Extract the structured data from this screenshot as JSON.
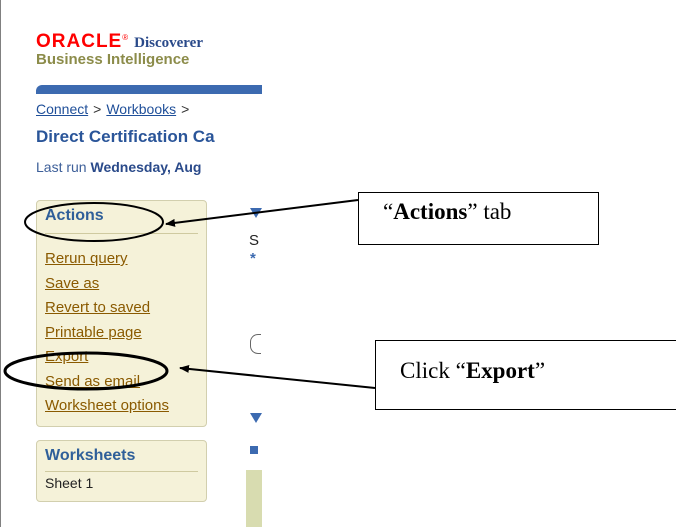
{
  "header": {
    "logo_text": "ORACLE",
    "logo_mark": "®",
    "product": "Discoverer",
    "subtitle": "Business Intelligence"
  },
  "breadcrumb": {
    "items": [
      "Connect",
      "Workbooks"
    ],
    "separator": ">"
  },
  "page_title": "Direct Certification Ca",
  "last_run": {
    "prefix": "Last run",
    "value": "Wednesday, Aug"
  },
  "actions_panel": {
    "title": "Actions",
    "items": [
      "Rerun query",
      "Save as",
      "Revert to saved",
      "Printable page",
      "Export",
      "Send as email",
      "Worksheet options"
    ]
  },
  "worksheets_panel": {
    "title": "Worksheets",
    "items": [
      "Sheet 1"
    ]
  },
  "content_fragments": {
    "letter_s": "S",
    "asterisk": "*"
  },
  "annotations": {
    "actions_callout": {
      "q_open": "“",
      "bold": "Actions",
      "q_close": "”",
      "rest": " tab"
    },
    "export_callout": {
      "prefix": "Click ",
      "q_open": "“",
      "bold": "Export",
      "q_close": "”"
    }
  },
  "colors": {
    "oracle_red": "#ff0000",
    "link_brown": "#8a5a00",
    "title_blue": "#2a5599",
    "panel_bg": "#f5f2d9",
    "bar_blue": "#3c6ab0"
  }
}
